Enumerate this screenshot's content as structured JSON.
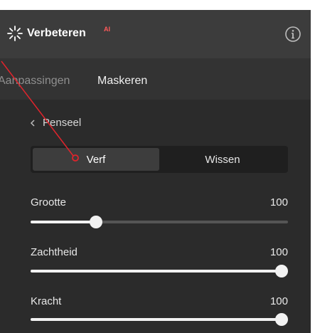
{
  "header": {
    "title": "Verbeteren",
    "ai_badge": "AI",
    "sparkle_icon": "sparkle-icon",
    "info_icon": "info-icon"
  },
  "tabs": [
    {
      "label": "Aanpassingen",
      "active": false
    },
    {
      "label": "Maskeren",
      "active": true
    }
  ],
  "breadcrumb": {
    "back_icon": "chevron-left-icon",
    "label": "Penseel"
  },
  "brush_mode": {
    "options": [
      "Verf",
      "Wissen"
    ],
    "selected": "Verf"
  },
  "sliders": [
    {
      "label": "Grootte",
      "value_text": "100",
      "fill_fraction": 0.24
    },
    {
      "label": "Zachtheid",
      "value_text": "100",
      "fill_fraction": 1.0
    },
    {
      "label": "Kracht",
      "value_text": "100",
      "fill_fraction": 1.0
    }
  ],
  "colors": {
    "panel": "#2b2b2b",
    "header": "#3c3c3c",
    "tab_bar": "#333333",
    "ai_badge": "#ff5a5a",
    "annotation": "#e0242c"
  }
}
